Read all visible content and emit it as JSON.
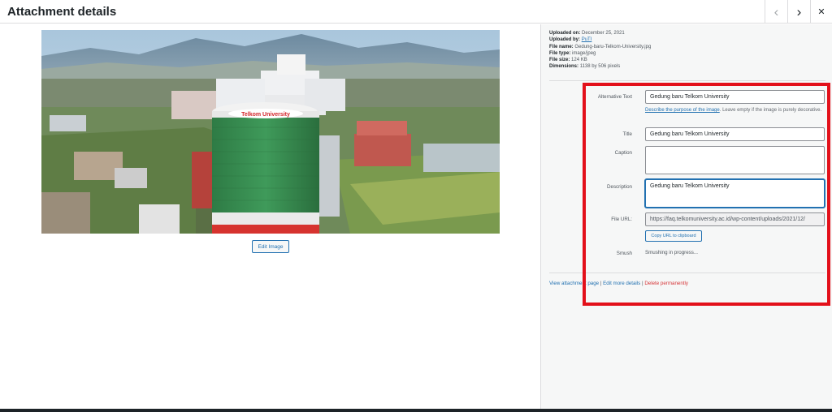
{
  "header": {
    "title": "Attachment details",
    "prev_icon": "‹",
    "next_icon": "›",
    "close_icon": "✕"
  },
  "image": {
    "alt": "Gedung baru Telkom University",
    "sign_text": "Telkom University"
  },
  "edit_image_label": "Edit Image",
  "meta": {
    "uploaded_on_label": "Uploaded on:",
    "uploaded_on": "December 25, 2021",
    "uploaded_by_label": "Uploaded by:",
    "uploaded_by": "PuTI",
    "file_name_label": "File name:",
    "file_name": "Gedung-baru-Telkom-University.jpg",
    "file_type_label": "File type:",
    "file_type": "image/jpeg",
    "file_size_label": "File size:",
    "file_size": "124 KB",
    "dimensions_label": "Dimensions:",
    "dimensions": "1138 by 506 pixels"
  },
  "fields": {
    "alt_text_label": "Alternative Text",
    "alt_text_value": "Gedung baru Telkom University",
    "help_link": "Describe the purpose of the image",
    "help_text": ". Leave empty if the image is purely decorative.",
    "title_label": "Title",
    "title_value": "Gedung baru Telkom University",
    "caption_label": "Caption",
    "caption_value": "",
    "description_label": "Description",
    "description_value": "Gedung baru Telkom University",
    "file_url_label": "File URL:",
    "file_url_value": "https://faq.telkomuniversity.ac.id/wp-content/uploads/2021/12/",
    "copy_url_label": "Copy URL to clipboard",
    "smush_label": "Smush",
    "smush_status": "Smushing in progress..."
  },
  "actions": {
    "view_page": "View attachment page",
    "separator": " | ",
    "edit_more": "Edit more details",
    "delete": "Delete permanently"
  },
  "colors": {
    "link": "#2271b1",
    "delete": "#d63638",
    "highlight": "#e3101a",
    "sidebar_bg": "#f6f7f7"
  }
}
